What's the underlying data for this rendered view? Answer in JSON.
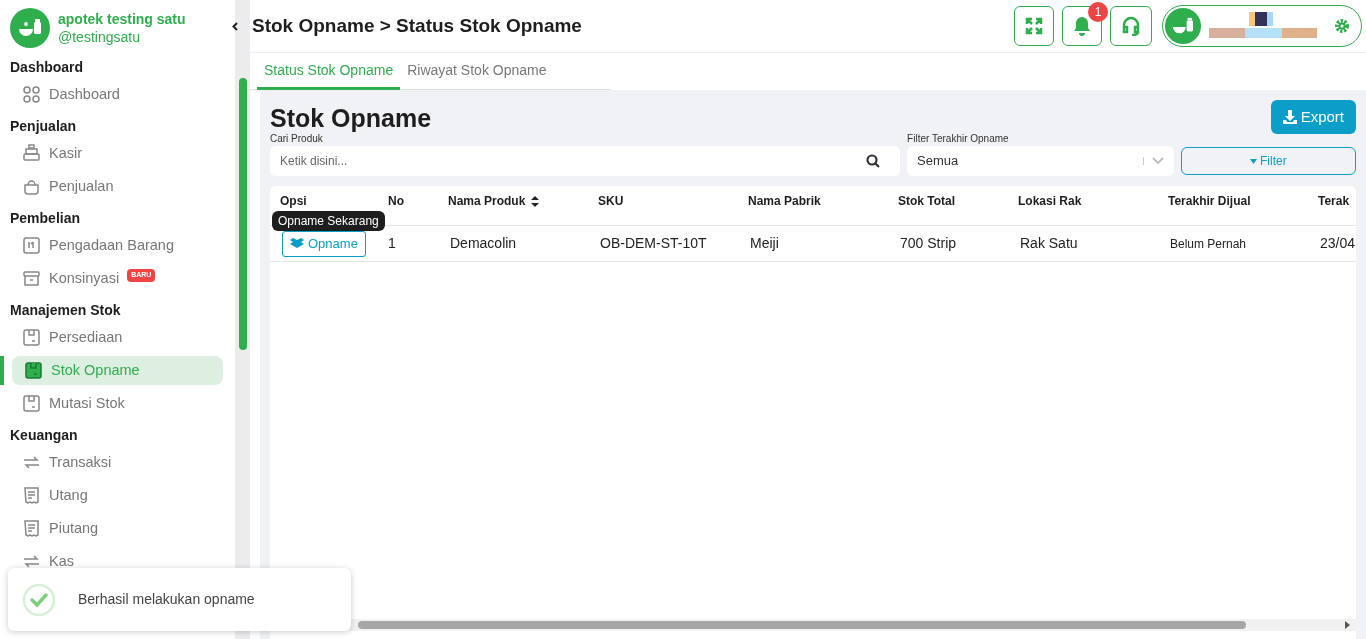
{
  "brand": {
    "name": "apotek testing satu",
    "handle": "@testingsatu"
  },
  "sidebar": {
    "sections": [
      {
        "title": "Dashboard",
        "items": [
          {
            "label": "Dashboard",
            "selected": false
          }
        ]
      },
      {
        "title": "Penjualan",
        "items": [
          {
            "label": "Kasir",
            "selected": false
          },
          {
            "label": "Penjualan",
            "selected": false
          }
        ]
      },
      {
        "title": "Pembelian",
        "items": [
          {
            "label": "Pengadaan Barang",
            "selected": false
          },
          {
            "label": "Konsinyasi",
            "selected": false,
            "badge": "BARU"
          }
        ]
      },
      {
        "title": "Manajemen Stok",
        "items": [
          {
            "label": "Persediaan",
            "selected": false
          },
          {
            "label": "Stok Opname",
            "selected": true
          },
          {
            "label": "Mutasi Stok",
            "selected": false
          }
        ]
      },
      {
        "title": "Keuangan",
        "items": [
          {
            "label": "Transaksi",
            "selected": false
          },
          {
            "label": "Utang",
            "selected": false
          },
          {
            "label": "Piutang",
            "selected": false
          },
          {
            "label": "Kas",
            "selected": false
          }
        ]
      }
    ]
  },
  "header": {
    "title": "Stok Opname > Status Stok Opname",
    "notification_count": "1"
  },
  "tabs": [
    {
      "label": "Status Stok Opname",
      "selected": true
    },
    {
      "label": "Riwayat Stok Opname",
      "selected": false
    }
  ],
  "page": {
    "title": "Stok Opname",
    "export_button": "Export",
    "search": {
      "label": "Cari Produk",
      "placeholder": "Ketik disini..."
    },
    "filter_select": {
      "label": "Filter Terakhir Opname",
      "value": "Semua"
    },
    "filter_button": "Filter"
  },
  "table": {
    "columns": [
      "Opsi",
      "No",
      "Nama Produk",
      "SKU",
      "Nama Pabrik",
      "Stok Total",
      "Lokasi Rak",
      "Terakhir Dijual",
      "Terak"
    ],
    "rows": [
      {
        "tooltip": "Opname Sekarang",
        "cells": [
          "Opname",
          "1",
          "Demacolin",
          "OB-DEM-ST-10T",
          "Meiji",
          "700 Strip",
          "Rak Satu",
          "Belum Pernah",
          "23/04"
        ]
      }
    ]
  },
  "toast": {
    "message": "Berhasil melakukan opname"
  }
}
